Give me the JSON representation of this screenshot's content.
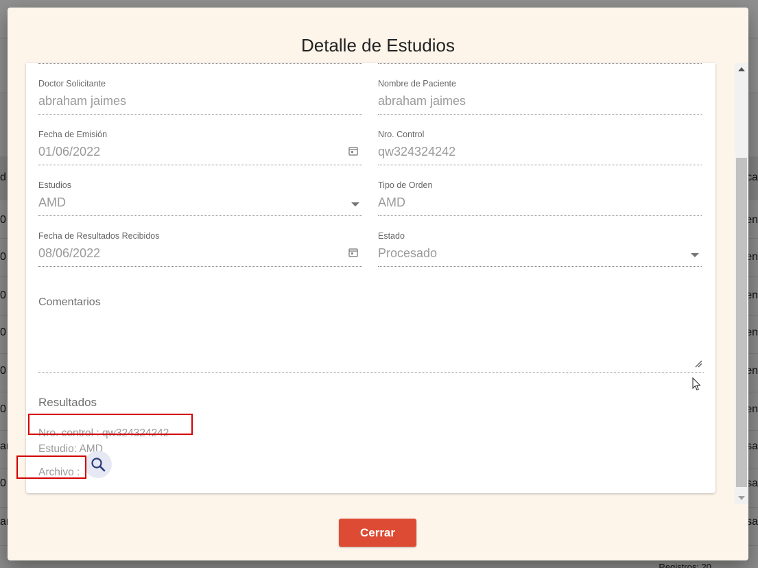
{
  "background": {
    "left_header_fragment": "d",
    "right_header_fragment": "ca",
    "left_cells": [
      "0",
      "0",
      "0",
      "0",
      "0",
      "0",
      "an",
      "0",
      "an"
    ],
    "right_cells": [
      "en",
      "en",
      "en",
      "en",
      "en",
      "en",
      "sa",
      "sa",
      "sa"
    ],
    "footer_text": "Registros: 20"
  },
  "dialog": {
    "title": "Detalle de Estudios",
    "fields": {
      "doctor": {
        "label": "Doctor Solicitante",
        "value": "abraham jaimes"
      },
      "patient": {
        "label": "Nombre de Paciente",
        "value": "abraham jaimes"
      },
      "issue_date": {
        "label": "Fecha de Emisión",
        "value": "01/06/2022"
      },
      "control": {
        "label": "Nro. Control",
        "value": "qw324324242"
      },
      "studies": {
        "label": "Estudios",
        "value": "AMD"
      },
      "order_type": {
        "label": "Tipo de Orden",
        "value": "AMD"
      },
      "results_date": {
        "label": "Fecha de Resultados Recibidos",
        "value": "08/06/2022"
      },
      "status": {
        "label": "Estado",
        "value": "Procesado"
      }
    },
    "comments_label": "Comentarios",
    "results": {
      "title": "Resultados",
      "control_line": "Nro. control : qw324324242",
      "study_line": "Estudio: AMD",
      "file_label": "Archivo :"
    },
    "close_label": "Cerrar"
  },
  "colors": {
    "dialog_bg": "#fdf5ea",
    "close_button": "#dd4b34",
    "highlight_box": "#d20000",
    "search_icon": "#2b3a7a"
  },
  "icons": [
    "calendar-icon",
    "chevron-down-icon",
    "search-icon",
    "resize-handle-icon",
    "mouse-cursor-icon"
  ]
}
